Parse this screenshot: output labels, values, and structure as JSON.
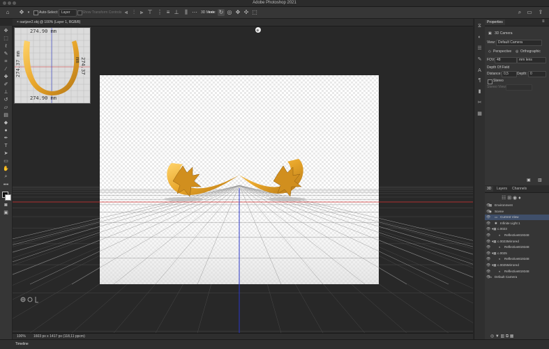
{
  "window": {
    "title": "Adobe Photoshop 2021"
  },
  "options_bar": {
    "auto_select_label": "Auto-Select:",
    "auto_select_value": "Layer",
    "transform_controls_label": "Show Transform Controls",
    "mode_label": "3D Mode:"
  },
  "document": {
    "tab_label": "oarijzer2.obj @ 100% (Layer 1, RGB/8)"
  },
  "navigator": {
    "dim_top": "274.90 mm",
    "dim_bottom": "274.90 mm",
    "dim_left": "274.37 mm",
    "dim_right": "274.37 mm"
  },
  "status_bar": {
    "zoom": "100%",
    "doc_size": "1603 px x 1417 px (118,11 ppcm)"
  },
  "timeline": {
    "label": "Timeline"
  },
  "properties": {
    "tab_label": "Properties",
    "section_title": "3D Camera",
    "view_label": "View:",
    "view_value": "Default Camera",
    "perspective_label": "Perspective",
    "orthographic_label": "Orthographic",
    "fov_label": "FOV:",
    "fov_value": "48",
    "fov_unit": "mm lens",
    "dof_label": "Depth Of Field",
    "distance_label": "Distance:",
    "distance_value": "0,5",
    "depth_label": "Depth:",
    "depth_value": "0",
    "stereo_label": "Stereo",
    "stereo_view_label": "Stereo View:"
  },
  "layers_panel": {
    "tabs": [
      "3D",
      "Layers",
      "Channels"
    ],
    "scene_items": [
      "Environment",
      "Scene",
      "Current View",
      "Infinite Light 1",
      "c.0023",
      "Reflective819348",
      "c.0023Mirrored",
      "Reflective819348",
      "c.0025",
      "Reflective819348",
      "c.0025Mirrored",
      "Reflective819348",
      "Default Camera"
    ]
  },
  "colors": {
    "accent": "#e7a52a",
    "selection_highlight": "#3f4f6a",
    "axis_red": "#d22b2b",
    "axis_blue": "#2a36c8"
  }
}
